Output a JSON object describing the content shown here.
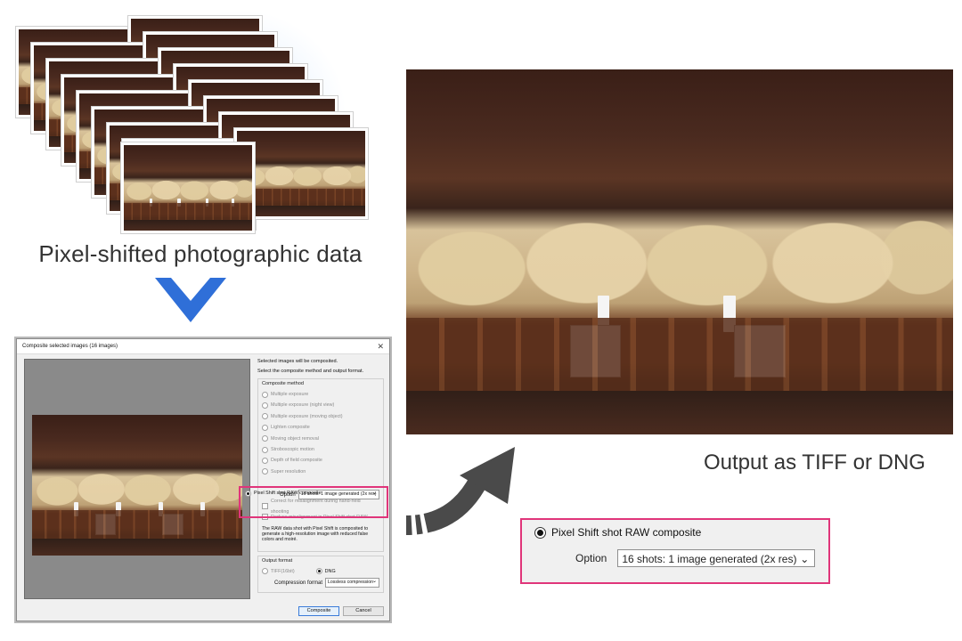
{
  "captions": {
    "input": "Pixel-shifted photographic data",
    "output": "Output as TIFF or DNG"
  },
  "dialog": {
    "title": "Composite selected images (16 images)",
    "close_glyph": "✕",
    "intro_1": "Selected images will be composited.",
    "intro_2": "Select the composite method and output format.",
    "composite_method_label": "Composite method",
    "methods": [
      "Multiple exposure",
      "Multiple exposure (night view)",
      "Multiple exposure (moving object)",
      "Lighten composite",
      "Moving object removal",
      "Stroboscopic motion",
      "Depth of field composite",
      "Super resolution"
    ],
    "selected_method": "Pixel Shift shot RAW composite",
    "option_label": "Option",
    "option_value": "16 shots: 1 image generated (2x res)",
    "check_1": "Correct for misalignment during hand-held shooting",
    "check_2": "Reduce misalignment in Pixel Shift shot RAW",
    "description": "The RAW data shot with Pixel Shift is composited to generate a high-resolution image with reduced false colors and moiré.",
    "output_format_label": "Output format",
    "format_tiff": "TIFF(16bit)",
    "format_dng": "DNG",
    "compression_label": "Compression format",
    "compression_value": "Lossless compression",
    "composite_button": "Composite",
    "cancel_button": "Cancel"
  },
  "callout": {
    "radio_label": "Pixel Shift shot RAW composite",
    "option_label": "Option",
    "option_value": "16 shots: 1 image generated (2x res)"
  },
  "colors": {
    "highlight": "#e0357a",
    "arrow_blue": "#2f6fd8",
    "arrow_gray": "#4a4a4a"
  }
}
